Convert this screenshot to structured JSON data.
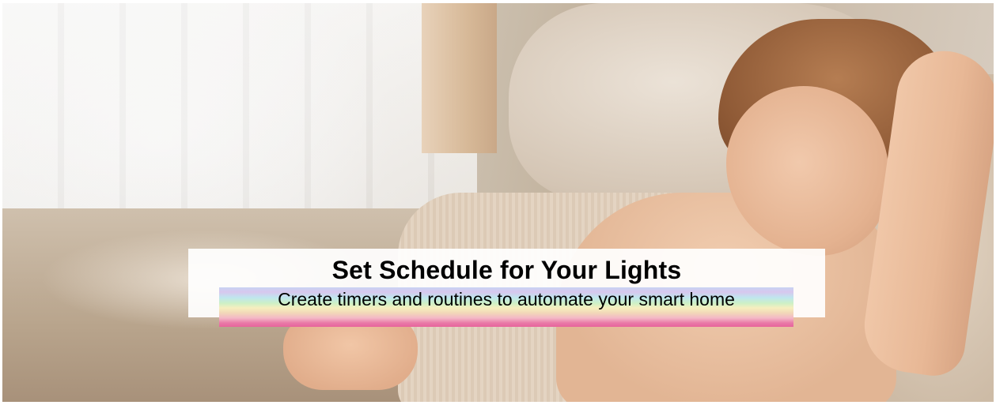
{
  "banner": {
    "title": "Set Schedule for Your Lights",
    "subtitle": "Create timers and routines to automate your smart home"
  },
  "colors": {
    "title_text": "#000000",
    "caption_background": "#ffffff",
    "subtitle_highlight": [
      "#c9d3f2",
      "#bfe6ee",
      "#cdf0c6",
      "#f6efbf",
      "#f3b7c6",
      "#e7649b"
    ]
  }
}
